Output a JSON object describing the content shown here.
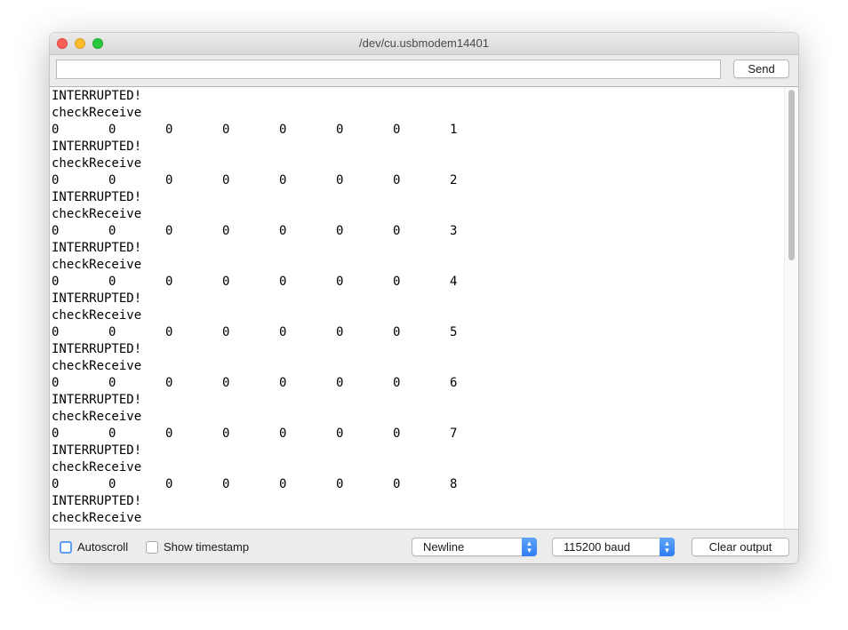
{
  "window": {
    "title": "/dev/cu.usbmodem14401"
  },
  "toolbar": {
    "input_value": "",
    "send_label": "Send"
  },
  "output": {
    "entries": [
      [
        "INTERRUPTED!"
      ],
      [
        "checkReceive"
      ],
      [
        "0",
        "0",
        "0",
        "0",
        "0",
        "0",
        "0",
        "1"
      ],
      [
        "INTERRUPTED!"
      ],
      [
        "checkReceive"
      ],
      [
        "0",
        "0",
        "0",
        "0",
        "0",
        "0",
        "0",
        "2"
      ],
      [
        "INTERRUPTED!"
      ],
      [
        "checkReceive"
      ],
      [
        "0",
        "0",
        "0",
        "0",
        "0",
        "0",
        "0",
        "3"
      ],
      [
        "INTERRUPTED!"
      ],
      [
        "checkReceive"
      ],
      [
        "0",
        "0",
        "0",
        "0",
        "0",
        "0",
        "0",
        "4"
      ],
      [
        "INTERRUPTED!"
      ],
      [
        "checkReceive"
      ],
      [
        "0",
        "0",
        "0",
        "0",
        "0",
        "0",
        "0",
        "5"
      ],
      [
        "INTERRUPTED!"
      ],
      [
        "checkReceive"
      ],
      [
        "0",
        "0",
        "0",
        "0",
        "0",
        "0",
        "0",
        "6"
      ],
      [
        "INTERRUPTED!"
      ],
      [
        "checkReceive"
      ],
      [
        "0",
        "0",
        "0",
        "0",
        "0",
        "0",
        "0",
        "7"
      ],
      [
        "INTERRUPTED!"
      ],
      [
        "checkReceive"
      ],
      [
        "0",
        "0",
        "0",
        "0",
        "0",
        "0",
        "0",
        "8"
      ],
      [
        "INTERRUPTED!"
      ],
      [
        "checkReceive"
      ]
    ]
  },
  "bottom": {
    "autoscroll_label": "Autoscroll",
    "autoscroll_checked": false,
    "timestamp_label": "Show timestamp",
    "timestamp_checked": false,
    "line_ending": "Newline",
    "baud_rate": "115200 baud",
    "clear_label": "Clear output"
  },
  "colors": {
    "select_accent": "#2e7ef3",
    "close": "#fe5f57",
    "minimize": "#febc2e",
    "maximize": "#28c840"
  }
}
